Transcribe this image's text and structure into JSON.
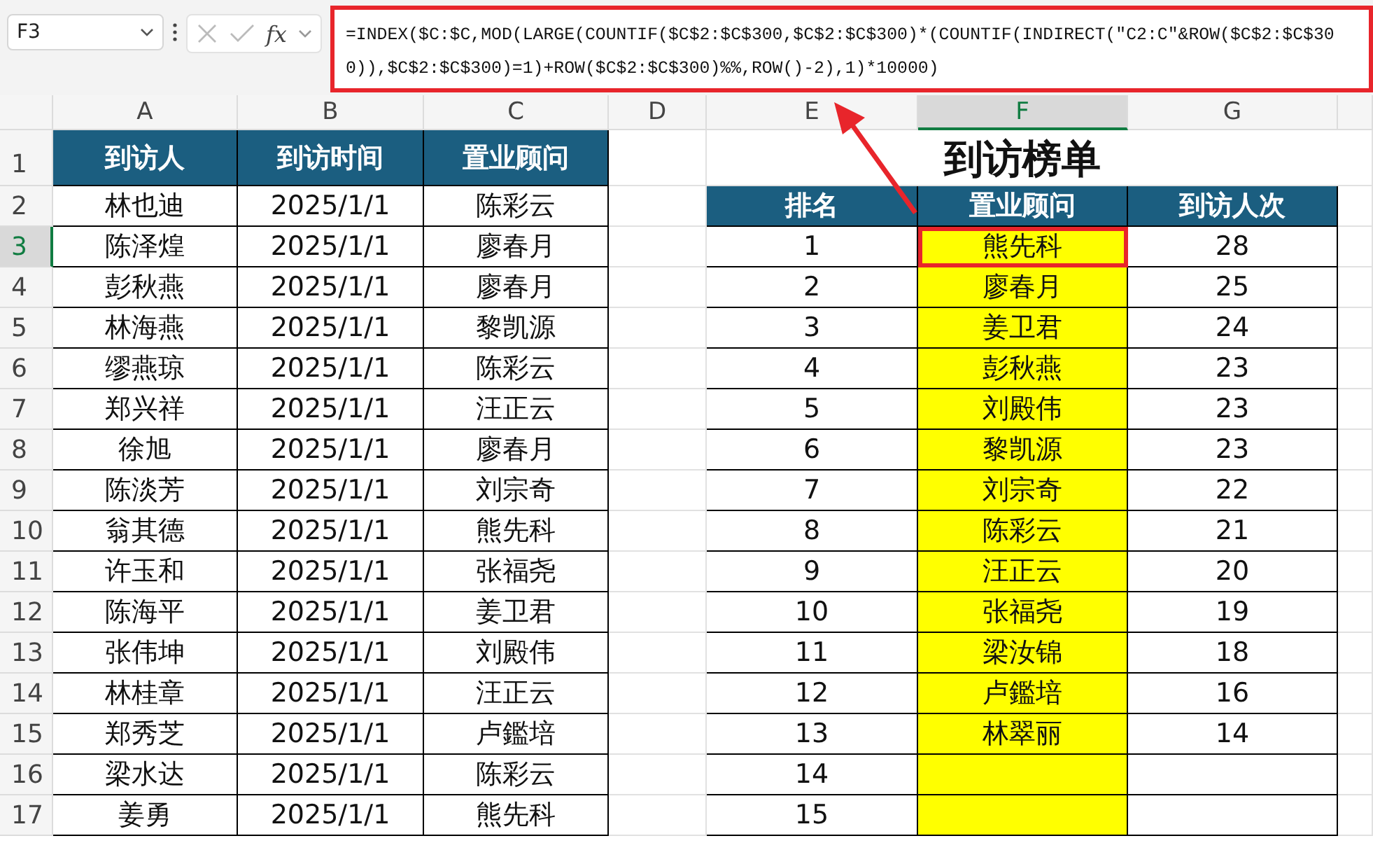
{
  "formula_bar": {
    "name_box": "F3",
    "fx": "fx",
    "formula": "=INDEX($C:$C,MOD(LARGE(COUNTIF($C$2:$C$300,$C$2:$C$300)*(COUNTIF(INDIRECT(\"C2:C\"&ROW($C$2:$C$300)),$C$2:$C$300)=1)+ROW($C$2:$C$300)%%,ROW()-2),1)*10000)"
  },
  "column_headers": [
    {
      "label": "A",
      "selected": false
    },
    {
      "label": "B",
      "selected": false
    },
    {
      "label": "C",
      "selected": false
    },
    {
      "label": "D",
      "selected": false
    },
    {
      "label": "E",
      "selected": false
    },
    {
      "label": "F",
      "selected": true
    },
    {
      "label": "G",
      "selected": false
    }
  ],
  "row_headers": [
    {
      "label": "1",
      "selected": false
    },
    {
      "label": "2",
      "selected": false
    },
    {
      "label": "3",
      "selected": true
    },
    {
      "label": "4",
      "selected": false
    },
    {
      "label": "5",
      "selected": false
    },
    {
      "label": "6",
      "selected": false
    },
    {
      "label": "7",
      "selected": false
    },
    {
      "label": "8",
      "selected": false
    },
    {
      "label": "9",
      "selected": false
    },
    {
      "label": "10",
      "selected": false
    },
    {
      "label": "11",
      "selected": false
    },
    {
      "label": "12",
      "selected": false
    },
    {
      "label": "13",
      "selected": false
    },
    {
      "label": "14",
      "selected": false
    },
    {
      "label": "15",
      "selected": false
    },
    {
      "label": "16",
      "selected": false
    },
    {
      "label": "17",
      "selected": false
    }
  ],
  "visits_table": {
    "columns": [
      "到访人",
      "到访时间",
      "置业顾问"
    ],
    "rows": [
      [
        "林也迪",
        "2025/1/1",
        "陈彩云"
      ],
      [
        "陈泽煌",
        "2025/1/1",
        "廖春月"
      ],
      [
        "彭秋燕",
        "2025/1/1",
        "廖春月"
      ],
      [
        "林海燕",
        "2025/1/1",
        "黎凯源"
      ],
      [
        "缪燕琼",
        "2025/1/1",
        "陈彩云"
      ],
      [
        "郑兴祥",
        "2025/1/1",
        "汪正云"
      ],
      [
        "徐旭",
        "2025/1/1",
        "廖春月"
      ],
      [
        "陈淡芳",
        "2025/1/1",
        "刘宗奇"
      ],
      [
        "翁其德",
        "2025/1/1",
        "熊先科"
      ],
      [
        "许玉和",
        "2025/1/1",
        "张福尧"
      ],
      [
        "陈海平",
        "2025/1/1",
        "姜卫君"
      ],
      [
        "张伟坤",
        "2025/1/1",
        "刘殿伟"
      ],
      [
        "林桂章",
        "2025/1/1",
        "汪正云"
      ],
      [
        "郑秀芝",
        "2025/1/1",
        "卢鑑培"
      ],
      [
        "梁水达",
        "2025/1/1",
        "陈彩云"
      ],
      [
        "姜勇",
        "2025/1/1",
        "熊先科"
      ]
    ]
  },
  "ranking": {
    "title": "到访榜单",
    "columns": [
      "排名",
      "置业顾问",
      "到访人次"
    ],
    "rows": [
      {
        "rank": "1",
        "consultant": "熊先科",
        "visits": "28",
        "selected": true
      },
      {
        "rank": "2",
        "consultant": "廖春月",
        "visits": "25",
        "selected": false
      },
      {
        "rank": "3",
        "consultant": "姜卫君",
        "visits": "24",
        "selected": false
      },
      {
        "rank": "4",
        "consultant": "彭秋燕",
        "visits": "23",
        "selected": false
      },
      {
        "rank": "5",
        "consultant": "刘殿伟",
        "visits": "23",
        "selected": false
      },
      {
        "rank": "6",
        "consultant": "黎凯源",
        "visits": "23",
        "selected": false
      },
      {
        "rank": "7",
        "consultant": "刘宗奇",
        "visits": "22",
        "selected": false
      },
      {
        "rank": "8",
        "consultant": "陈彩云",
        "visits": "21",
        "selected": false
      },
      {
        "rank": "9",
        "consultant": "汪正云",
        "visits": "20",
        "selected": false
      },
      {
        "rank": "10",
        "consultant": "张福尧",
        "visits": "19",
        "selected": false
      },
      {
        "rank": "11",
        "consultant": "梁汝锦",
        "visits": "18",
        "selected": false
      },
      {
        "rank": "12",
        "consultant": "卢鑑培",
        "visits": "16",
        "selected": false
      },
      {
        "rank": "13",
        "consultant": "林翠丽",
        "visits": "14",
        "selected": false
      },
      {
        "rank": "14",
        "selected": false
      },
      {
        "rank": "15",
        "selected": false
      }
    ]
  }
}
